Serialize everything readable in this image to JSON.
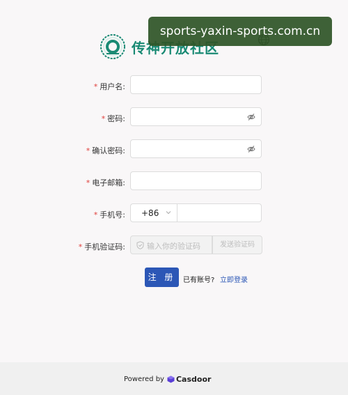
{
  "brand": {
    "name": "传神开放社区"
  },
  "watermark": {
    "text": "sports-yaxin-sports.com.cn"
  },
  "form": {
    "required_mark": "*",
    "username": {
      "label": "用户名:",
      "value": ""
    },
    "password": {
      "label": "密码:",
      "value": ""
    },
    "confirm_password": {
      "label": "确认密码:",
      "value": ""
    },
    "email": {
      "label": "电子邮箱:",
      "value": ""
    },
    "phone": {
      "label": "手机号:",
      "country_code": "+86",
      "value": ""
    },
    "verification": {
      "label": "手机验证码:",
      "placeholder": "输入你的验证码",
      "send_label": "发送验证码"
    }
  },
  "actions": {
    "register_label": "注 册",
    "have_account_text": "已有账号?",
    "login_link": "立即登录"
  },
  "footer": {
    "powered_by": "Powered by",
    "product": "Casdoor"
  },
  "colors": {
    "brand_green": "#1a8a74",
    "primary_blue": "#2c57b6",
    "required_red": "#e0403d"
  }
}
